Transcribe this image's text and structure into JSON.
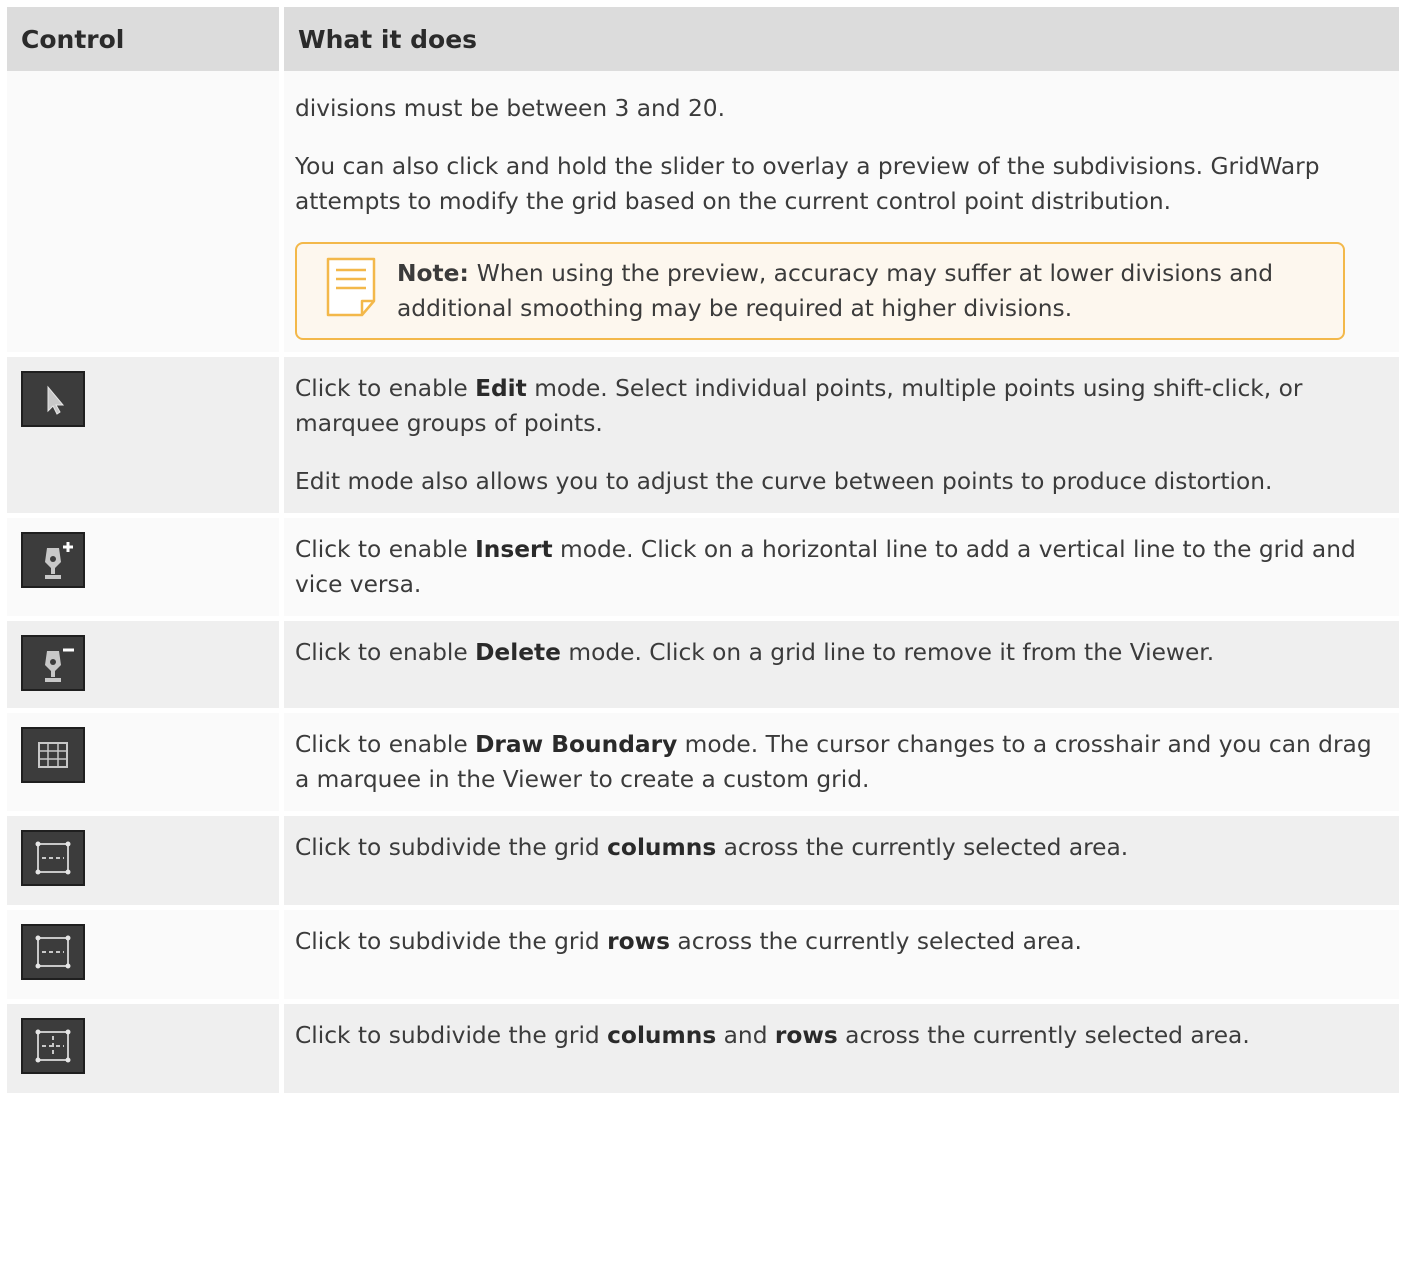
{
  "header": {
    "col_control": "Control",
    "col_what": "What it does"
  },
  "rows": [
    {
      "icon": "",
      "paragraphs": [
        "divisions must be between 3 and 20.",
        "You can also click and hold the slider to overlay a preview of the subdivisions. GridWarp attempts to modify the grid based on the current control point distribution."
      ],
      "note": {
        "label": "Note:",
        "text": "When using the preview, accuracy may suffer at lower divisions and additional smoothing may be required at higher divisions."
      }
    },
    {
      "icon": "edit-arrow-icon",
      "p1_before": "Click to enable ",
      "p1_bold": "Edit",
      "p1_after": " mode. Select individual points, multiple points using shift-click, or marquee groups of points.",
      "p2": "Edit mode also allows you to adjust the curve between points to produce distortion."
    },
    {
      "icon": "insert-pen-icon",
      "before": "Click to enable ",
      "bold": "Insert",
      "after": " mode. Click on a horizontal line to add a vertical line to the grid and vice versa."
    },
    {
      "icon": "delete-pen-icon",
      "before": "Click to enable ",
      "bold": "Delete",
      "after": " mode. Click on a grid line to remove it from the Viewer."
    },
    {
      "icon": "draw-boundary-grid-icon",
      "before": "Click to enable ",
      "bold": "Draw Boundary",
      "after": " mode. The cursor changes to a crosshair and you can drag a marquee in the Viewer to create a custom grid."
    },
    {
      "icon": "subdivide-columns-icon",
      "before": "Click to subdivide the grid ",
      "bold": "columns",
      "after": " across the currently selected area."
    },
    {
      "icon": "subdivide-rows-icon",
      "before": "Click to subdivide the grid ",
      "bold": "rows",
      "after": " across the currently selected area."
    },
    {
      "icon": "subdivide-columns-rows-icon",
      "before": "Click to subdivide the grid ",
      "bold": "columns",
      "middle": " and ",
      "bold2": "rows",
      "after": " across the currently selected area."
    }
  ],
  "colors": {
    "header_bg": "#dcdcdc",
    "row_odd_bg": "#fafafa",
    "row_even_bg": "#efefef",
    "note_border": "#f3b84a",
    "note_bg": "#fdf7ee",
    "icon_bg": "#3c3c3c"
  }
}
